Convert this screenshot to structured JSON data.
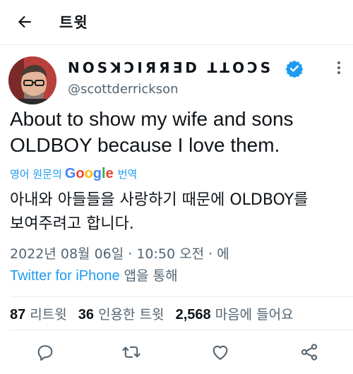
{
  "header": {
    "title": "트윗"
  },
  "author": {
    "display_name": "SCOTT DERRICKSON",
    "display_name_rendered": "NOSꓘƆIЯЯƎD ꓕꓕOƆS",
    "handle": "@scottderrickson",
    "verified": true
  },
  "tweet": {
    "text_line_1": "About to show my wife and sons",
    "text_line_2": "OLDBOY because I love them."
  },
  "translate": {
    "prefix": "영어 원문의",
    "brand": "Google",
    "suffix": "번역"
  },
  "translation": {
    "line_1": "아내와 아들들을 사랑하기 때문에 OLDBOY를",
    "line_2": "보여주려고 합니다."
  },
  "meta": {
    "date_time": "2022년 08월 06일 · 10:50 오전 · 에"
  },
  "source": {
    "client": "Twitter for iPhone",
    "suffix": "앱을 통해"
  },
  "stats": {
    "retweets_count": "87",
    "retweets_label": "리트윗",
    "quotes_count": "36",
    "quotes_label": "인용한 트윗",
    "likes_count": "2,568",
    "likes_label": "마음에 들어요"
  },
  "colors": {
    "accent": "#1d9bf0",
    "muted": "#536471",
    "text": "#0f1419",
    "divider": "#e6ecf0"
  },
  "icons": {
    "back": "arrow-left-icon",
    "verified": "verified-badge-icon",
    "more": "more-vertical-icon",
    "reply": "reply-icon",
    "retweet": "retweet-icon",
    "like": "heart-icon",
    "share": "share-icon"
  }
}
